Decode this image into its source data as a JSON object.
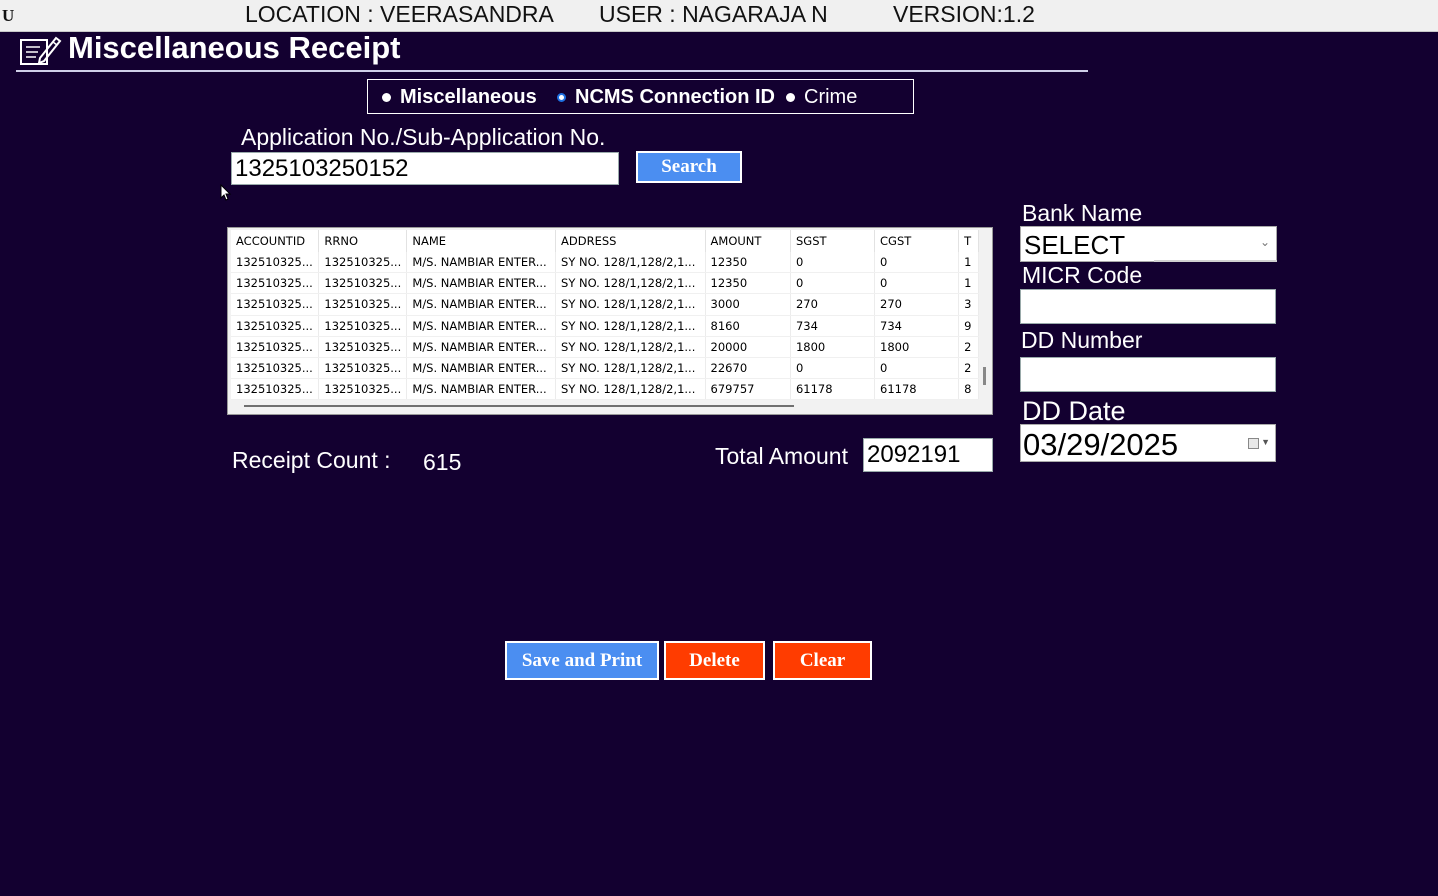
{
  "topbar": {
    "prefix": "U",
    "location": "LOCATION : VEERASANDRA",
    "user": "USER :   NAGARAJA N",
    "version": "VERSION:1.2"
  },
  "page": {
    "title": "Miscellaneous Receipt",
    "icon": "edit-document-icon"
  },
  "receipt_type": {
    "options": [
      {
        "label": "Miscellaneous",
        "selected": false
      },
      {
        "label": "NCMS Connection ID",
        "selected": true
      },
      {
        "label": "Crime",
        "selected": false
      }
    ]
  },
  "application": {
    "label": "Application No./Sub-Application No.",
    "value": "1325103250152",
    "search_label": "Search"
  },
  "grid": {
    "columns": [
      "ACCOUNTID",
      "RRNO",
      "NAME",
      "ADDRESS",
      "AMOUNT",
      "SGST",
      "CGST",
      "T"
    ],
    "rows": [
      [
        "132510325...",
        "132510325...",
        "M/S. NAMBIAR ENTER...",
        "SY NO. 128/1,128/2,1...",
        "12350",
        "0",
        "0",
        "1"
      ],
      [
        "132510325...",
        "132510325...",
        "M/S. NAMBIAR ENTER...",
        "SY NO. 128/1,128/2,1...",
        "12350",
        "0",
        "0",
        "1"
      ],
      [
        "132510325...",
        "132510325...",
        "M/S. NAMBIAR ENTER...",
        "SY NO. 128/1,128/2,1...",
        "3000",
        "270",
        "270",
        "3"
      ],
      [
        "132510325...",
        "132510325...",
        "M/S. NAMBIAR ENTER...",
        "SY NO. 128/1,128/2,1...",
        "8160",
        "734",
        "734",
        "9"
      ],
      [
        "132510325...",
        "132510325...",
        "M/S. NAMBIAR ENTER...",
        "SY NO. 128/1,128/2,1...",
        "20000",
        "1800",
        "1800",
        "2"
      ],
      [
        "132510325...",
        "132510325...",
        "M/S. NAMBIAR ENTER...",
        "SY NO. 128/1,128/2,1...",
        "22670",
        "0",
        "0",
        "2"
      ],
      [
        "132510325...",
        "132510325...",
        "M/S. NAMBIAR ENTER...",
        "SY NO. 128/1,128/2,1...",
        "679757",
        "61178",
        "61178",
        "8"
      ]
    ]
  },
  "summary": {
    "receipt_count_label": "Receipt Count :",
    "receipt_count": "615",
    "total_amount_label": "Total Amount",
    "total_amount": "2092191"
  },
  "bank": {
    "bank_name_label": "Bank Name",
    "bank_name_value": "SELECT",
    "micr_label": "MICR Code",
    "micr_value": "",
    "dd_number_label": "DD Number",
    "dd_number_value": "",
    "dd_date_label": "DD Date",
    "dd_date_value": "03/29/2025"
  },
  "actions": {
    "save_print": "Save and Print",
    "delete": "Delete",
    "clear": "Clear"
  },
  "colors": {
    "background": "#130030",
    "button_blue": "#4b8ef1",
    "button_red": "#ff3c00"
  }
}
